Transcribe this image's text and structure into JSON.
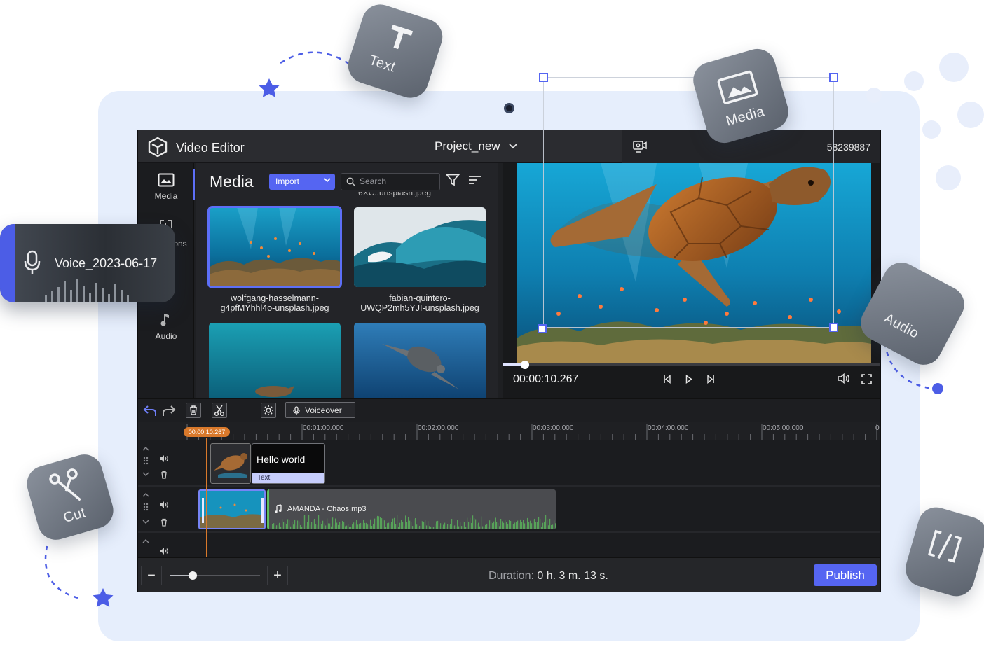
{
  "app": {
    "title": "Video Editor",
    "project_name": "Project_new",
    "session_id_fragment": "58239887"
  },
  "sidebar": {
    "items": [
      {
        "label": "Media",
        "icon": "image-icon",
        "active": true
      },
      {
        "label": "ons",
        "icon": "transitions-icon"
      },
      {
        "label": "Audio",
        "icon": "music-note-icon"
      }
    ]
  },
  "media_panel": {
    "title": "Media",
    "import_label": "Import",
    "search_placeholder": "Search",
    "cutoff_filename": "6XC..unsplash.jpeg",
    "items": [
      {
        "filename_line1": "wolfgang-hasselmann-",
        "filename_line2": "g4pfMYhhl4o-unsplash.jpeg",
        "selected": true
      },
      {
        "filename_line1": "fabian-quintero-",
        "filename_line2": "UWQP2mh5YJI-unsplash.jpeg",
        "selected": false
      },
      {
        "filename_line1": "",
        "filename_line2": "",
        "selected": false
      },
      {
        "filename_line1": "",
        "filename_line2": "",
        "selected": false
      }
    ]
  },
  "preview": {
    "timecode": "00:00:10.267",
    "progress_fraction": 0.06
  },
  "timeline": {
    "voiceover_label": "Voiceover",
    "playhead_time": "00:00:10.267",
    "ruler_labels": [
      "00:01:00.000",
      "00:02:00.000",
      "00:03:00.000",
      "00:04:00.000",
      "00:05:00.000",
      "00"
    ],
    "text_clip": {
      "body": "Hello world",
      "tag": "Text"
    },
    "audio_clip": {
      "name": "AMANDA - Chaos.mp3"
    }
  },
  "bottom": {
    "duration_label": "Duration:",
    "duration_value": "0 h. 3 m. 13 s.",
    "publish_label": "Publish",
    "zoom_fraction": 0.25
  },
  "floating_cards": {
    "text": "Text",
    "media": "Media",
    "audio": "Audio",
    "cut": "Cut",
    "voice_file": "Voice_2023-06-17"
  },
  "colors": {
    "accent": "#5565f2",
    "playhead": "#d9792b",
    "backdrop": "#e6eefc",
    "audio_wave": "#5dbf5d"
  }
}
